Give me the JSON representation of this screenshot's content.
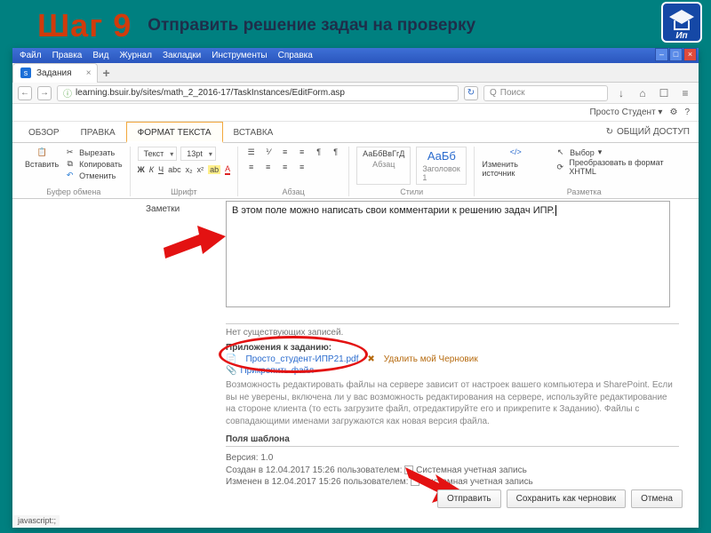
{
  "step_number": "Шаг 9",
  "step_title": "Отправить решение задач на проверку",
  "browser": {
    "menu": [
      "Файл",
      "Правка",
      "Вид",
      "Журнал",
      "Закладки",
      "Инструменты",
      "Справка"
    ],
    "tab_title": "Задания",
    "url": "learning.bsuir.by/sites/math_2_2016-17/TaskInstances/EditForm.asp",
    "search_placeholder": "Поиск",
    "status_bar": "javascript:;"
  },
  "sp": {
    "user": "Просто Студент",
    "tabs": {
      "overview": "ОБЗОР",
      "edit": "ПРАВКА",
      "format": "ФОРМАТ ТЕКСТА",
      "insert": "ВСТАВКА"
    },
    "share": "ОБЩИЙ ДОСТУП"
  },
  "ribbon": {
    "paste": "Вставить",
    "cut": "Вырезать",
    "copy": "Копировать",
    "undo": "Отменить",
    "g_clip": "Буфер обмена",
    "font_style": "Текст",
    "font_size": "13pt",
    "g_font": "Шрифт",
    "g_para": "Абзац",
    "style1": "АаБбВвГгД",
    "style1_sub": "Абзац",
    "style2": "АаБб",
    "style2_sub": "Заголовок 1",
    "g_styles": "Стили",
    "src": "Изменить источник",
    "select": "Выбор",
    "xhtml": "Преобразовать в формат XHTML",
    "g_markup": "Разметка"
  },
  "form": {
    "notes_label": "Заметки",
    "notes_value": "В этом поле можно написать свои комментарии к решению задач ИПР.",
    "no_entries": "Нет существующих записей.",
    "att_header": "Приложения к заданию:",
    "pdf_name": "Просто_студент-ИПР21.pdf",
    "del_draft": "Удалить мой Черновик",
    "attach": "Прикрепить файл",
    "gray_note": "Возможность редактировать файлы на сервере зависит от настроек вашего компьютера и SharePoint. Если вы не уверены, включена ли у вас возможность редактирования на сервере, используйте редактирование на стороне клиента (то есть загрузите файл, отредактируйте его и прикрепите к Заданию). Файлы с совпадающими именами загружаются как новая версия файла.",
    "fields_label": "Поля шаблона",
    "version_line": "Версия: 1.0",
    "created_line": "Создан в 12.04.2017 15:26 пользователем:",
    "modified_line": "Изменен в 12.04.2017 15:26 пользователем:",
    "sys_account": "Системная учетная запись",
    "btn_submit": "Отправить",
    "btn_draft": "Сохранить как черновик",
    "btn_cancel": "Отмена"
  }
}
